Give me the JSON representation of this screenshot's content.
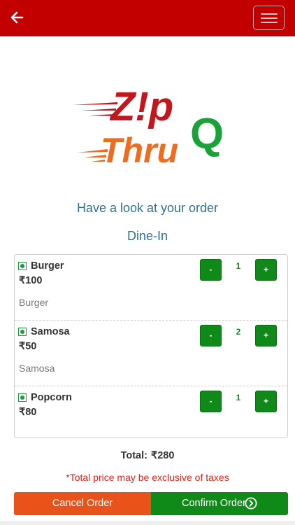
{
  "header": {
    "back_icon": "arrow-left-icon",
    "menu_icon": "hamburger-menu-icon",
    "background_color": "#c30000"
  },
  "logo": {
    "line1": "Z!p",
    "line2": "Thru",
    "letter": "Q",
    "colors": {
      "zip": "#c4161c",
      "thru": "#ef6b1d",
      "q": "#18a237"
    }
  },
  "page": {
    "title": "Have a look at your order",
    "order_type": "Dine-In"
  },
  "items": [
    {
      "name": "Burger",
      "price": "₹100",
      "description": "Burger",
      "quantity": "1",
      "minus_label": "-",
      "plus_label": "+"
    },
    {
      "name": "Samosa",
      "price": "₹50",
      "description": "Samosa",
      "quantity": "2",
      "minus_label": "-",
      "plus_label": "+"
    },
    {
      "name": "Popcorn",
      "price": "₹80",
      "description": "",
      "quantity": "1",
      "minus_label": "-",
      "plus_label": "+"
    }
  ],
  "summary": {
    "total_label": "Total:",
    "total_amount": "₹280",
    "tax_note": "*Total price may be exclusive of taxes"
  },
  "actions": {
    "cancel_label": "Cancel Order",
    "confirm_label": "Confirm Order",
    "confirm_icon": "circle-chevron-right-icon",
    "cancel_color": "#e9531a",
    "confirm_color": "#0f8a19"
  }
}
